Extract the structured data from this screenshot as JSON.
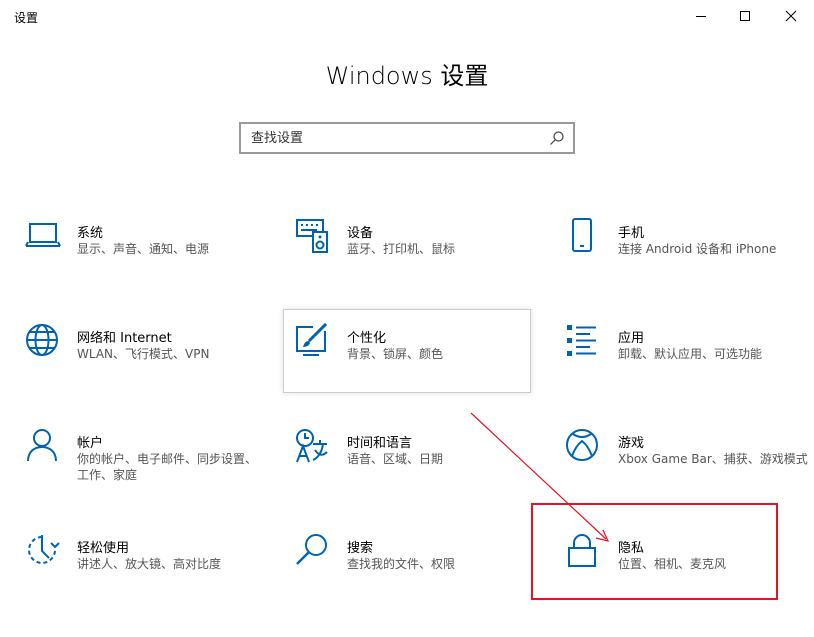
{
  "window": {
    "title": "设置"
  },
  "header": {
    "title": "Windows 设置"
  },
  "search": {
    "placeholder": "查找设置"
  },
  "tiles": [
    {
      "title": "系统",
      "desc": "显示、声音、通知、电源",
      "icon": "laptop-icon"
    },
    {
      "title": "设备",
      "desc": "蓝牙、打印机、鼠标",
      "icon": "keyboard-speaker-icon"
    },
    {
      "title": "手机",
      "desc": "连接 Android 设备和 iPhone",
      "icon": "phone-icon"
    },
    {
      "title": "网络和 Internet",
      "desc": "WLAN、飞行模式、VPN",
      "icon": "globe-icon"
    },
    {
      "title": "个性化",
      "desc": "背景、锁屏、颜色",
      "icon": "paint-icon"
    },
    {
      "title": "应用",
      "desc": "卸载、默认应用、可选功能",
      "icon": "apps-list-icon"
    },
    {
      "title": "帐户",
      "desc": "你的帐户、电子邮件、同步设置、工作、家庭",
      "icon": "person-icon"
    },
    {
      "title": "时间和语言",
      "desc": "语音、区域、日期",
      "icon": "time-language-icon"
    },
    {
      "title": "游戏",
      "desc": "Xbox Game Bar、捕获、游戏模式",
      "icon": "xbox-icon"
    },
    {
      "title": "轻松使用",
      "desc": "讲述人、放大镜、高对比度",
      "icon": "ease-of-access-icon"
    },
    {
      "title": "搜索",
      "desc": "查找我的文件、权限",
      "icon": "search-icon"
    },
    {
      "title": "隐私",
      "desc": "位置、相机、麦克风",
      "icon": "lock-icon"
    }
  ],
  "colors": {
    "accent": "#0063b1",
    "annotation": "#e81123"
  }
}
